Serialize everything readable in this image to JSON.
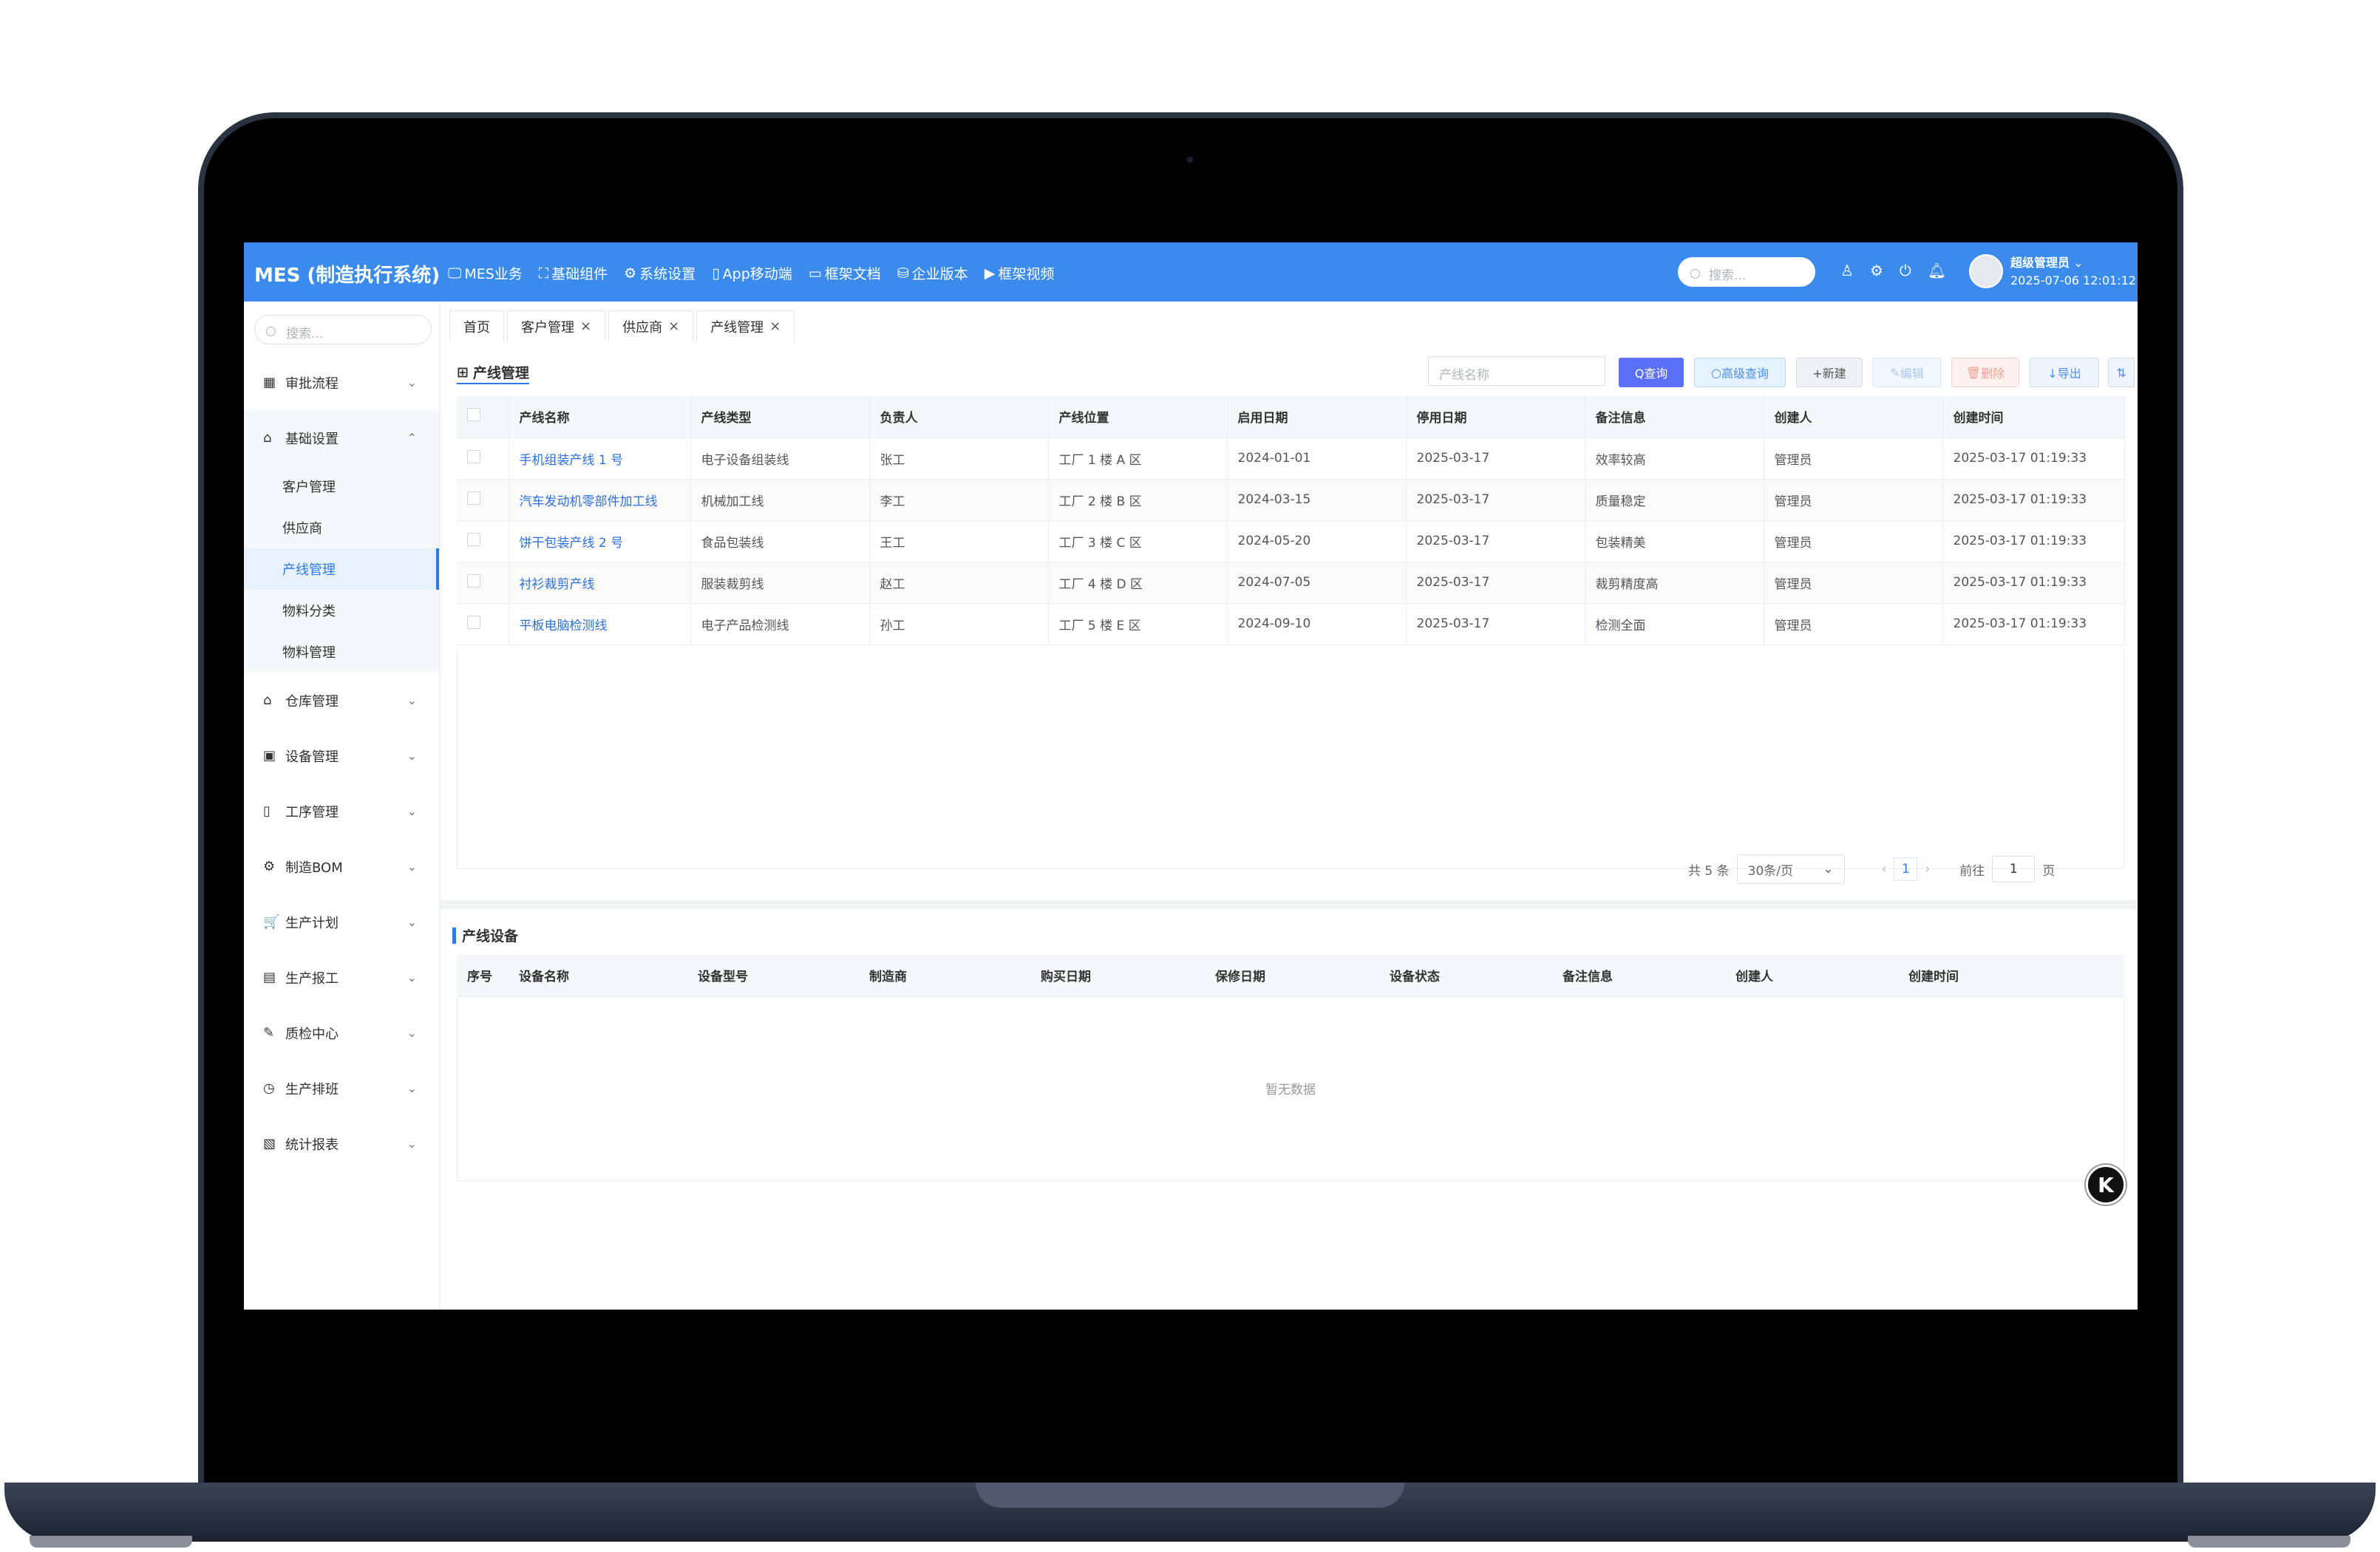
{
  "app": {
    "title": "MES (制造执行系统)"
  },
  "topnav": [
    {
      "icon": "monitor-icon",
      "glyph": "🖵",
      "label": "MES业务"
    },
    {
      "icon": "expand-icon",
      "glyph": "⛶",
      "label": "基础组件"
    },
    {
      "icon": "gear-icon",
      "glyph": "⚙",
      "label": "系统设置"
    },
    {
      "icon": "mobile-icon",
      "glyph": "▯",
      "label": "App移动端"
    },
    {
      "icon": "folder-icon",
      "glyph": "▭",
      "label": "框架文档"
    },
    {
      "icon": "database-icon",
      "glyph": "⛁",
      "label": "企业版本"
    },
    {
      "icon": "video-icon",
      "glyph": "▶",
      "label": "框架视频"
    }
  ],
  "header": {
    "search_placeholder": "搜索...",
    "user_name": "超级管理员",
    "datetime": "2025-07-06 12:01:12"
  },
  "sidebar": {
    "search_placeholder": "搜索...",
    "items": [
      {
        "label": "审批流程",
        "icon": "calendar-icon",
        "glyph": "▦",
        "expanded": false
      },
      {
        "label": "基础设置",
        "icon": "home-settings-icon",
        "glyph": "⌂",
        "expanded": true,
        "children": [
          {
            "label": "客户管理",
            "active": false
          },
          {
            "label": "供应商",
            "active": false
          },
          {
            "label": "产线管理",
            "active": true
          },
          {
            "label": "物料分类",
            "active": false
          },
          {
            "label": "物料管理",
            "active": false
          }
        ]
      },
      {
        "label": "仓库管理",
        "icon": "warehouse-icon",
        "glyph": "⌂",
        "expanded": false
      },
      {
        "label": "设备管理",
        "icon": "device-icon",
        "glyph": "▣",
        "expanded": false
      },
      {
        "label": "工序管理",
        "icon": "tablet-icon",
        "glyph": "▯",
        "expanded": false
      },
      {
        "label": "制造BOM",
        "icon": "cog-icon",
        "glyph": "⚙",
        "expanded": false
      },
      {
        "label": "生产计划",
        "icon": "cart-icon",
        "glyph": "🛒",
        "expanded": false
      },
      {
        "label": "生产报工",
        "icon": "document-icon",
        "glyph": "▤",
        "expanded": false
      },
      {
        "label": "质检中心",
        "icon": "edit-icon",
        "glyph": "✎",
        "expanded": false
      },
      {
        "label": "生产排班",
        "icon": "compass-icon",
        "glyph": "◷",
        "expanded": false
      },
      {
        "label": "统计报表",
        "icon": "chart-icon",
        "glyph": "▧",
        "expanded": false
      }
    ]
  },
  "tabs": [
    {
      "label": "首页",
      "closable": false
    },
    {
      "label": "客户管理",
      "closable": true
    },
    {
      "label": "供应商",
      "closable": true
    },
    {
      "label": "产线管理",
      "closable": true
    }
  ],
  "section1": {
    "title": "产线管理",
    "filter_placeholder": "产线名称",
    "buttons": {
      "query": "Q查询",
      "advanced": "高级查询",
      "new": "+新建",
      "edit": "编辑",
      "delete": "删除",
      "export": "↓导出"
    },
    "columns": [
      "产线名称",
      "产线类型",
      "负责人",
      "产线位置",
      "启用日期",
      "停用日期",
      "备注信息",
      "创建人",
      "创建时间"
    ],
    "rows": [
      [
        "手机组装产线 1 号",
        "电子设备组装线",
        "张工",
        "工厂 1 楼 A 区",
        "2024-01-01",
        "2025-03-17",
        "效率较高",
        "管理员",
        "2025-03-17 01:19:33"
      ],
      [
        "汽车发动机零部件加工线",
        "机械加工线",
        "李工",
        "工厂 2 楼 B 区",
        "2024-03-15",
        "2025-03-17",
        "质量稳定",
        "管理员",
        "2025-03-17 01:19:33"
      ],
      [
        "饼干包装产线 2 号",
        "食品包装线",
        "王工",
        "工厂 3 楼 C 区",
        "2024-05-20",
        "2025-03-17",
        "包装精美",
        "管理员",
        "2025-03-17 01:19:33"
      ],
      [
        "衬衫裁剪产线",
        "服装裁剪线",
        "赵工",
        "工厂 4 楼 D 区",
        "2024-07-05",
        "2025-03-17",
        "裁剪精度高",
        "管理员",
        "2025-03-17 01:19:33"
      ],
      [
        "平板电脑检测线",
        "电子产品检测线",
        "孙工",
        "工厂 5 楼 E 区",
        "2024-09-10",
        "2025-03-17",
        "检测全面",
        "管理员",
        "2025-03-17 01:19:33"
      ]
    ],
    "pager": {
      "total": "共 5 条",
      "page_size": "30条/页",
      "current": "1",
      "goto_label": "前往",
      "goto_value": "1",
      "page_suffix": "页"
    }
  },
  "section2": {
    "title": "产线设备",
    "columns": [
      "序号",
      "设备名称",
      "设备型号",
      "制造商",
      "购买日期",
      "保修日期",
      "设备状态",
      "备注信息",
      "创建人",
      "创建时间"
    ],
    "empty": "暂无数据"
  },
  "float_button": {
    "label": "K"
  },
  "colors": {
    "brand": "#3b8bec",
    "accent": "#2d7bea",
    "query_button": "#5b6ff6"
  }
}
